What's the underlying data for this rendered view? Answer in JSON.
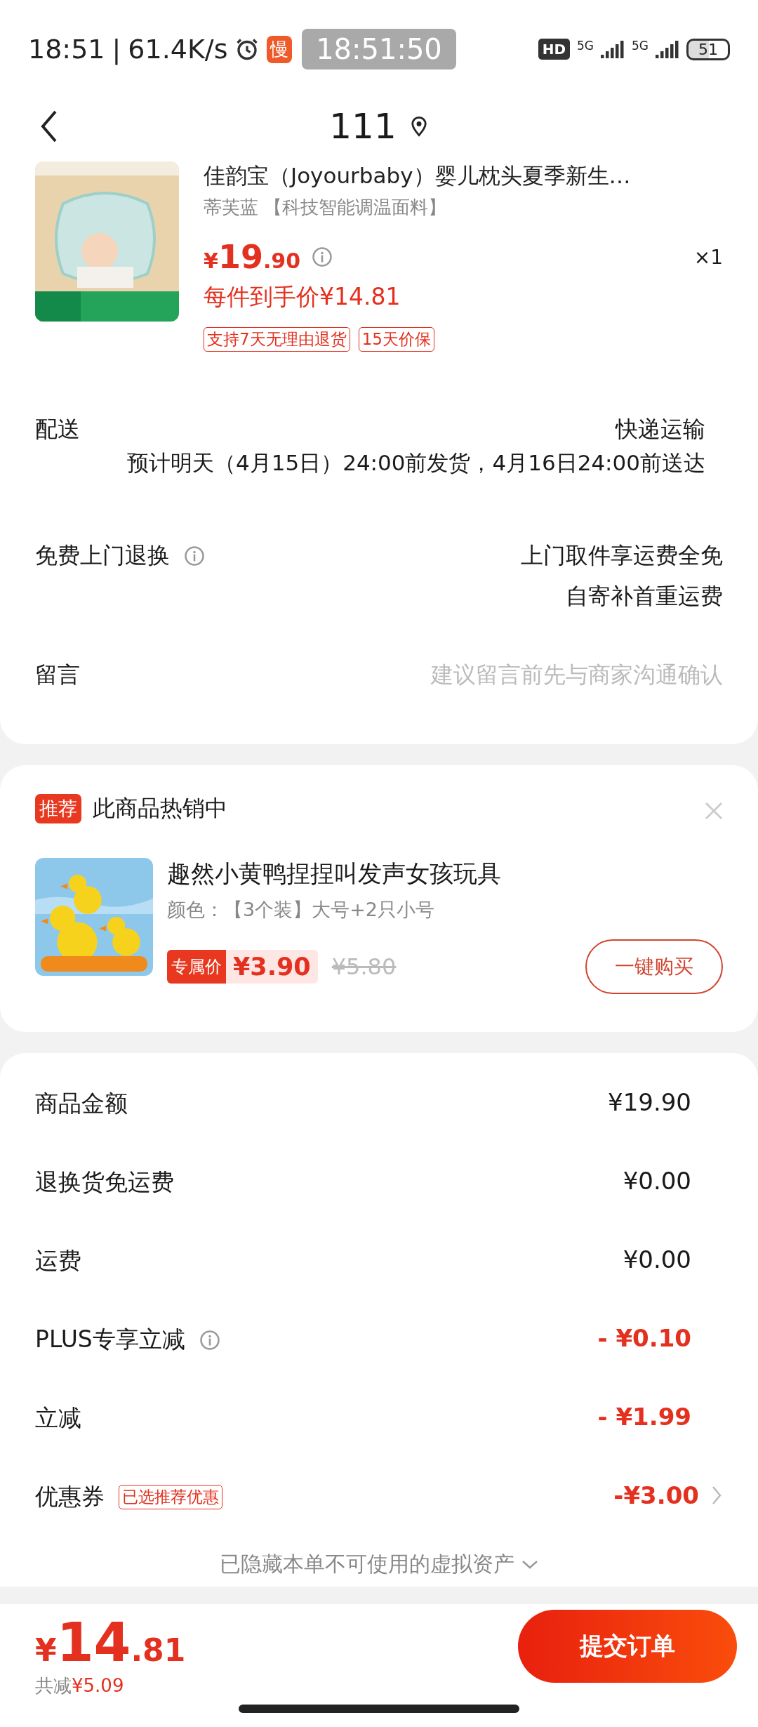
{
  "status_bar": {
    "time": "18:51",
    "separator": "|",
    "speed": "61.4K/s",
    "app_badge": "慢",
    "clock": "18:51:50",
    "hd": "HD",
    "network_1": "5G",
    "network_2": "5G",
    "battery": "51"
  },
  "header": {
    "title": "111"
  },
  "product": {
    "title": "佳韵宝（Joyourbaby）婴儿枕头夏季新生…",
    "variant": "蒂芙蓝 【科技智能调温面料】",
    "price_symbol": "¥",
    "price_int": "19",
    "price_dec": ".90",
    "quantity": "×1",
    "unit_price": "每件到手价¥14.81",
    "tags": [
      "支持7天无理由退货",
      "15天价保"
    ]
  },
  "delivery": {
    "label": "配送",
    "method": "快递运输",
    "estimate": "预计明天（4月15日）24:00前发货，4月16日24:00前送达"
  },
  "return_service": {
    "label": "免费上门退换",
    "lines": [
      "上门取件享运费全免",
      "自寄补首重运费"
    ]
  },
  "message": {
    "label": "留言",
    "placeholder": "建议留言前先与商家沟通确认"
  },
  "recommend": {
    "badge": "推荐",
    "title": "此商品热销中",
    "item": {
      "name": "趣然小黄鸭捏捏叫发声女孩玩具",
      "variant": "颜色：【3个装】大号+2只小号",
      "price_tag": "专属价",
      "price": "¥3.90",
      "old_price": "¥5.80",
      "button": "一键购买"
    }
  },
  "summary": {
    "rows": [
      {
        "label": "商品金额",
        "value": "¥19.90",
        "kind": "plain"
      },
      {
        "label": "退换货免运费",
        "value": "¥0.00",
        "kind": "plain"
      },
      {
        "label": "运费",
        "value": "¥0.00",
        "kind": "plain"
      },
      {
        "label": "PLUS专享立减",
        "value": "- ¥0.10",
        "kind": "discount",
        "info": true
      },
      {
        "label": "立减",
        "value": "- ¥1.99",
        "kind": "discount"
      },
      {
        "label": "优惠券",
        "tag": "已选推荐优惠",
        "value": "-¥3.00",
        "kind": "discount",
        "chevron": true
      }
    ],
    "hidden_note": "已隐藏本单不可使用的虚拟资产"
  },
  "footer": {
    "price_symbol": "¥",
    "price_int": "14",
    "price_dec": ".81",
    "saved_label": "共减",
    "saved": "¥5.09",
    "submit": "提交订单"
  }
}
